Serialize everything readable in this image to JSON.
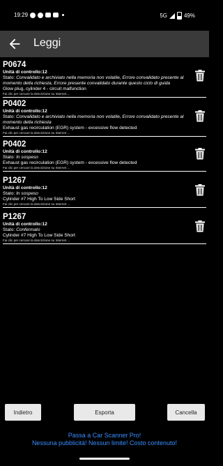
{
  "status_bar": {
    "time": "19:29",
    "network": "5G",
    "battery": "49%"
  },
  "app_bar": {
    "title": "Leggi",
    "back_icon": "arrow-left-icon"
  },
  "errors": [
    {
      "code": "P0674",
      "unit": "Unità di controllo:12",
      "status_label": "Stato: ",
      "status": "Convalidato e archiviato nella memoria non volatile, Errore convalidato presente al momento della richiesta, Errore presente convalidato durante questo ciclo di guida",
      "description": "Glow plug, cylinder 4 - circuit malfunction",
      "hint": "Fai clic per cercare la descrizione su Internet ..."
    },
    {
      "code": "P0402",
      "unit": "Unità di controllo:12",
      "status_label": "Stato: ",
      "status": "Convalidato e archiviato nella memoria non volatile, Errore convalidato presente al momento della richiesta",
      "description": "Exhaust gas recirculation (EGR) system - excessive flow detected",
      "hint": "Fai clic per cercare la descrizione su Internet ..."
    },
    {
      "code": "P0402",
      "unit": "Unità di controllo:12",
      "status_label": "Stato: ",
      "status": "In sospeso",
      "description": "Exhaust gas recirculation (EGR) system - excessive flow detected",
      "hint": "Fai clic per cercare la descrizione su Internet ..."
    },
    {
      "code": "P1267",
      "unit": "Unità di controllo:12",
      "status_label": "Stato: ",
      "status": "In sospeso",
      "description": "Cylinder #7 High To Low Side Short",
      "hint": "Fai clic per cercare la descrizione su Internet ..."
    },
    {
      "code": "P1267",
      "unit": "Unità di controllo:12",
      "status_label": "Stato: ",
      "status": "Confermato",
      "description": "Cylinder #7 High To Low Side Short",
      "hint": "Fai clic per cercare la descrizione su Internet ..."
    }
  ],
  "buttons": {
    "back": "Indietro",
    "export": "Esporta",
    "delete": "Cancella"
  },
  "promo": {
    "line1": "Passa a Car Scanner Pro!",
    "line2": "Nessuna pubblicità! Nessun limite! Costo contenuto!"
  },
  "colors": {
    "background": "#000000",
    "app_bar": "#3a3a3a",
    "promo_text": "#3a8dff",
    "button_bg": "#e9e9e9"
  }
}
